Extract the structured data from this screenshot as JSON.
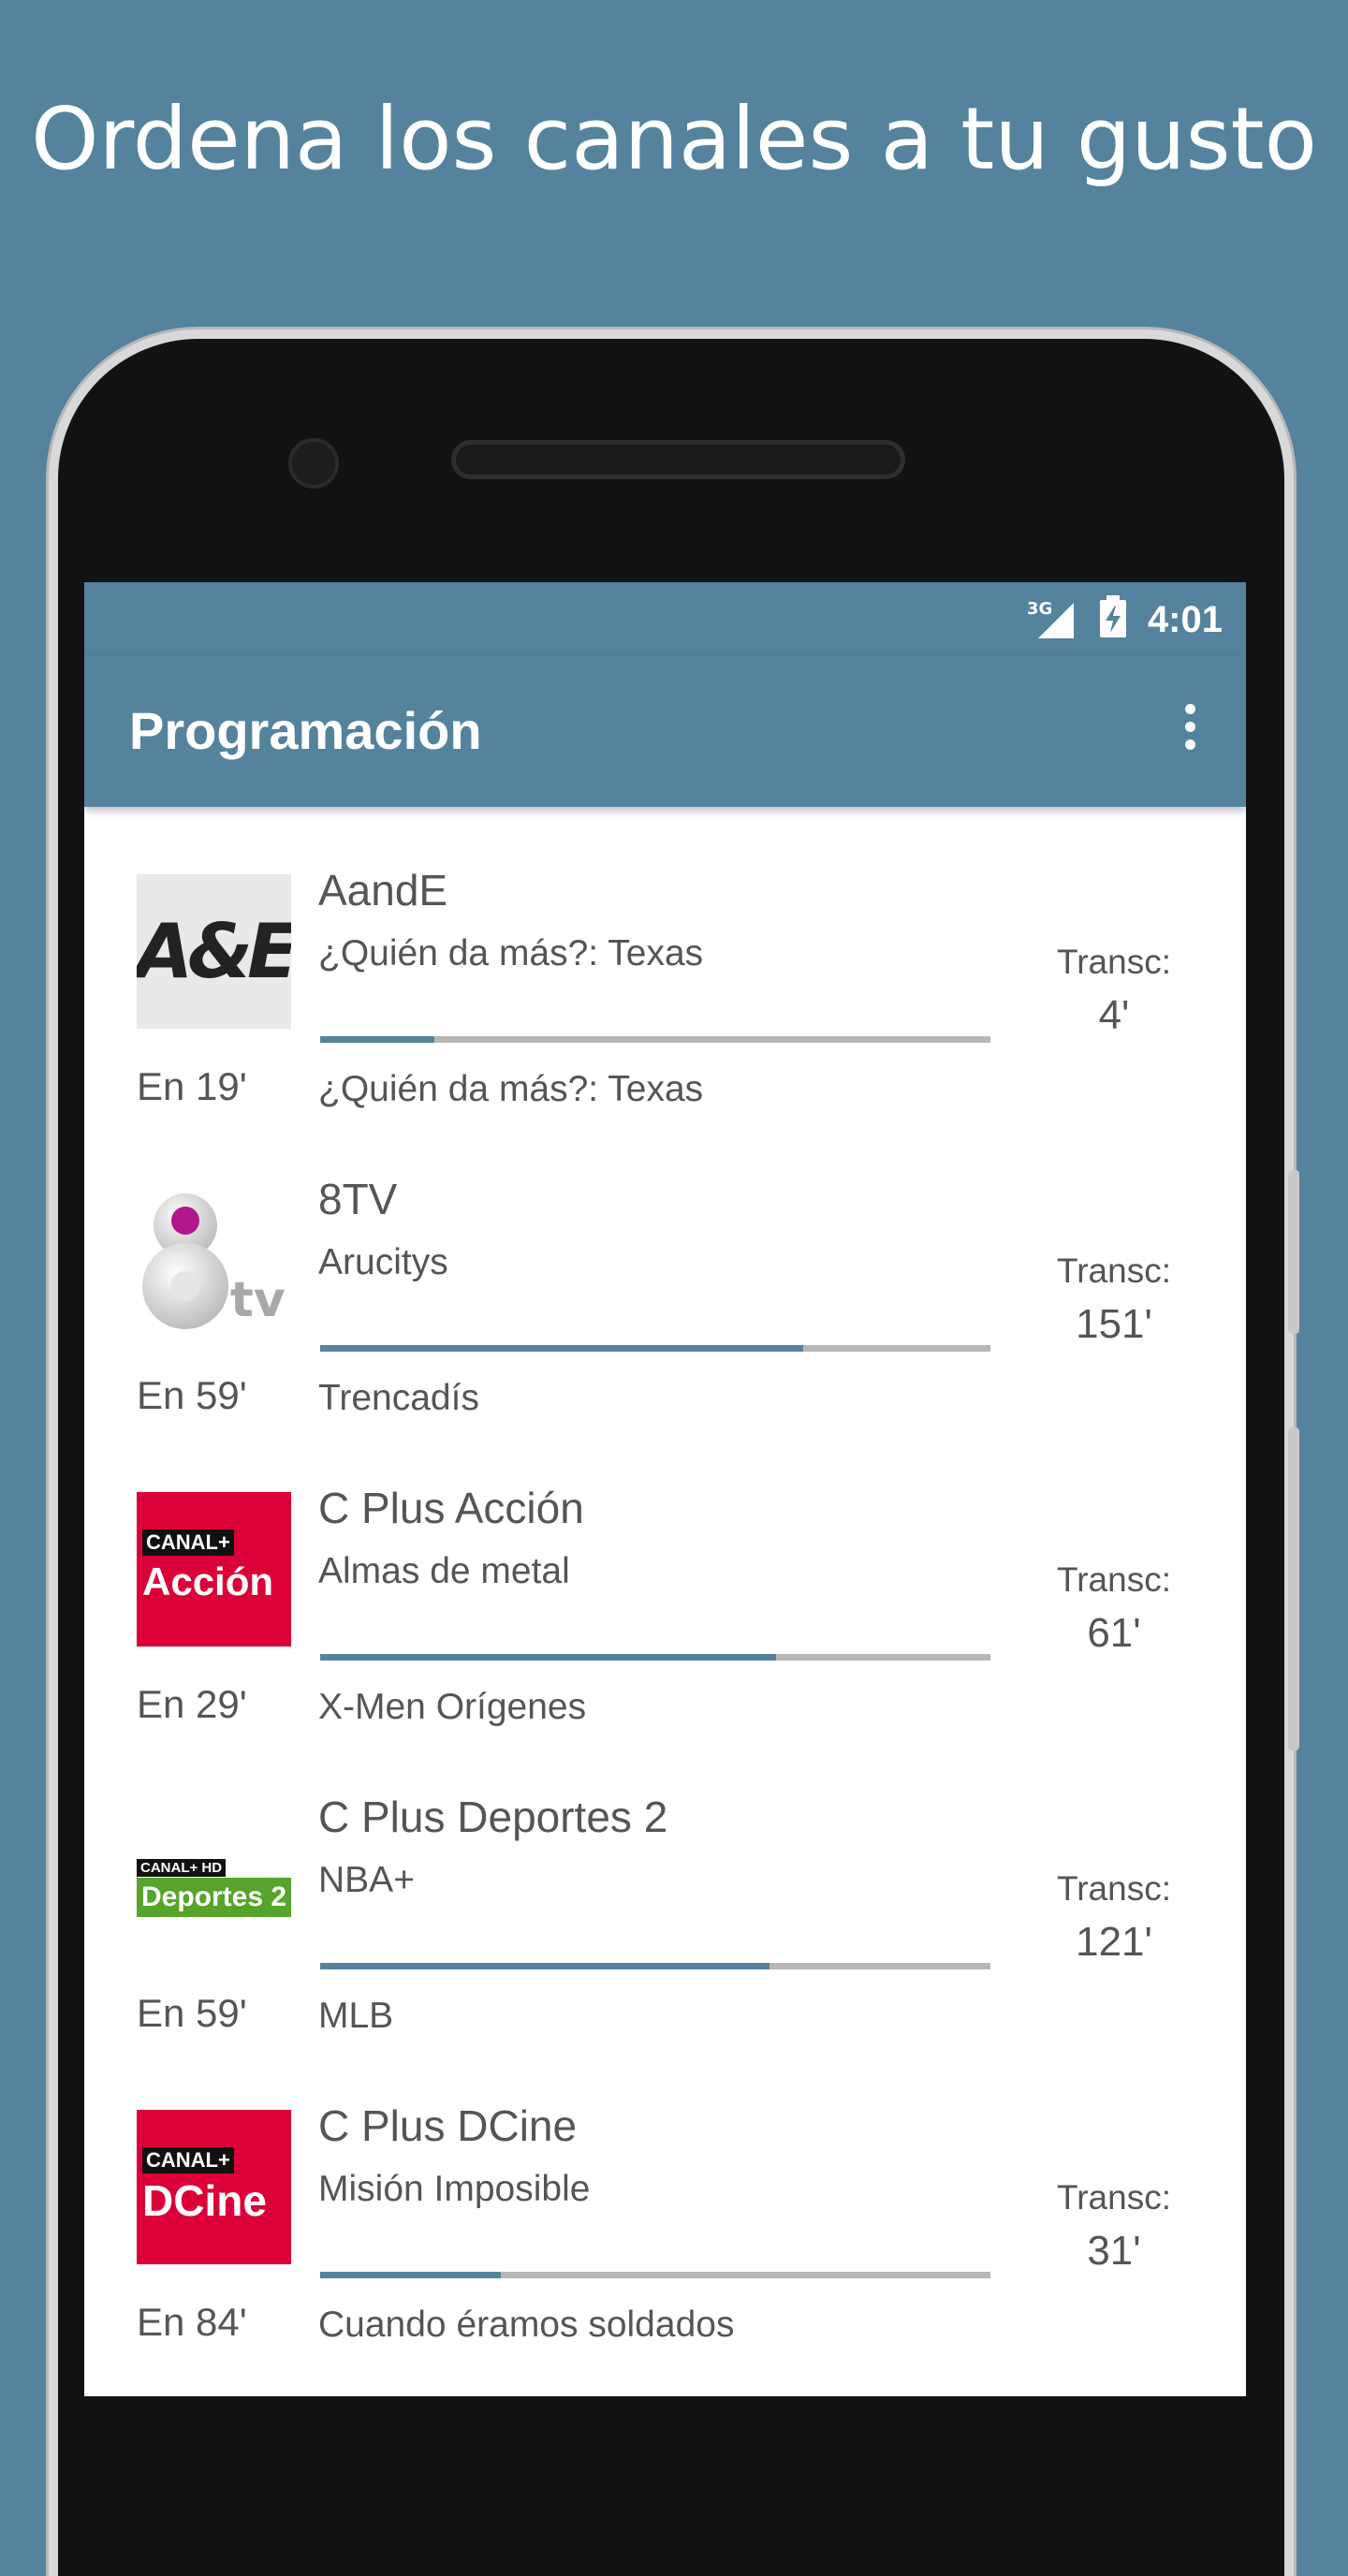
{
  "headline": "Ordena los canales a tu gusto",
  "status": {
    "network": "3G",
    "time": "4:01"
  },
  "appbar": {
    "title": "Programación",
    "menu_icon": "more-vert-icon"
  },
  "colors": {
    "primary": "#55829d",
    "progress_track": "#b7b7b7",
    "text": "#555555"
  },
  "channels": [
    {
      "name": "AandE",
      "logo": "ae-logo",
      "logo_text": "A&E",
      "now": "¿Quién da más?: Texas",
      "next": "¿Quién da más?: Texas",
      "starts_in": "En 19'",
      "elapsed_label": "Transc:",
      "elapsed": "4'",
      "progress": 0.17
    },
    {
      "name": "8TV",
      "logo": "8tv-logo",
      "logo_text": "8tv",
      "now": "Arucitys",
      "next": "Trencadís",
      "starts_in": "En 59'",
      "elapsed_label": "Transc:",
      "elapsed": "151'",
      "progress": 0.72
    },
    {
      "name": "C Plus Acción",
      "logo": "canal-plus-accion-logo",
      "logo_text_top": "CANAL+",
      "logo_text_bottom": "Acción",
      "now": "Almas de metal",
      "next": "X-Men Orígenes",
      "starts_in": "En 29'",
      "elapsed_label": "Transc:",
      "elapsed": "61'",
      "progress": 0.68
    },
    {
      "name": "C Plus Deportes 2",
      "logo": "canal-plus-deportes-2-logo",
      "logo_text_top": "CANAL+ HD",
      "logo_text_bottom": "Deportes 2",
      "now": "NBA+",
      "next": "MLB",
      "starts_in": "En 59'",
      "elapsed_label": "Transc:",
      "elapsed": "121'",
      "progress": 0.67
    },
    {
      "name": "C Plus DCine",
      "logo": "canal-plus-dcine-logo",
      "logo_text_top": "CANAL+",
      "logo_text_bottom": "DCine",
      "now": "Misión Imposible",
      "next": "Cuando éramos soldados",
      "starts_in": "En 84'",
      "elapsed_label": "Transc:",
      "elapsed": "31'",
      "progress": 0.27
    }
  ]
}
